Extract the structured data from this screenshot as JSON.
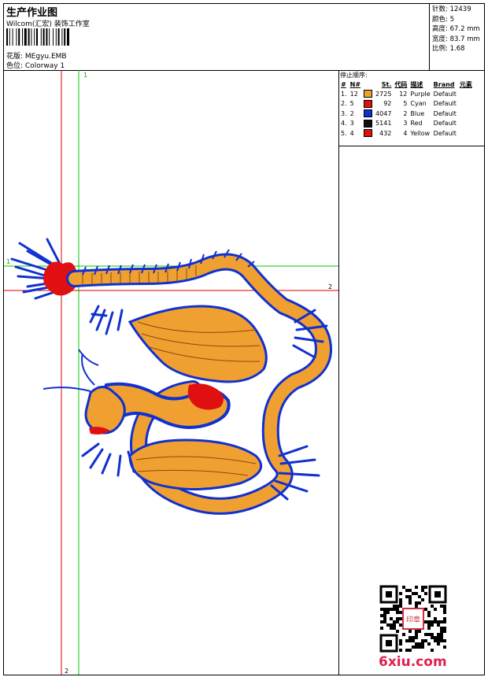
{
  "header": {
    "title": "生产作业图",
    "studio": "Wilcom(汇宏) 装饰工作室",
    "design_label": "花版:",
    "design_file": "MEgyu.EMB",
    "colorway_label": "色位:",
    "colorway": "Colorway 1"
  },
  "stats": [
    {
      "label": "针数:",
      "value": "12439"
    },
    {
      "label": "颜色:",
      "value": "5"
    },
    {
      "label": "高度:",
      "value": "67.2 mm"
    },
    {
      "label": "宽度:",
      "value": "83.7 mm"
    },
    {
      "label": "比例:",
      "value": "1.68"
    }
  ],
  "stop_sequence": {
    "title": "停止顺序:",
    "columns": [
      "#",
      "N#",
      "St.",
      "代码",
      "描述",
      "Brand",
      "元素"
    ],
    "rows": [
      {
        "idx": "1.",
        "n": "12",
        "color": "#f0a030",
        "st": "2725",
        "code": "12",
        "desc": "Purple",
        "brand": "Default"
      },
      {
        "idx": "2.",
        "n": "5",
        "color": "#e01010",
        "st": "92",
        "code": "5",
        "desc": "Cyan",
        "brand": "Default"
      },
      {
        "idx": "3.",
        "n": "2",
        "color": "#1030d0",
        "st": "4047",
        "code": "2",
        "desc": "Blue",
        "brand": "Default"
      },
      {
        "idx": "4.",
        "n": "3",
        "color": "#101010",
        "st": "5141",
        "code": "3",
        "desc": "Red",
        "brand": "Default"
      },
      {
        "idx": "5.",
        "n": "4",
        "color": "#e01010",
        "st": "432",
        "code": "4",
        "desc": "Yellow",
        "brand": "Default"
      }
    ]
  },
  "guides": {
    "green_v": "1",
    "green_h": "1",
    "red_h": "2",
    "red_v": "2"
  },
  "colors": {
    "dragon_body": "#f0a030",
    "dragon_outline": "#1030d0",
    "accent": "#e01010",
    "guide_red": "#e00000",
    "guide_green": "#00cc00"
  },
  "footer": {
    "logo": "6xiu.com",
    "seal": "印章"
  }
}
